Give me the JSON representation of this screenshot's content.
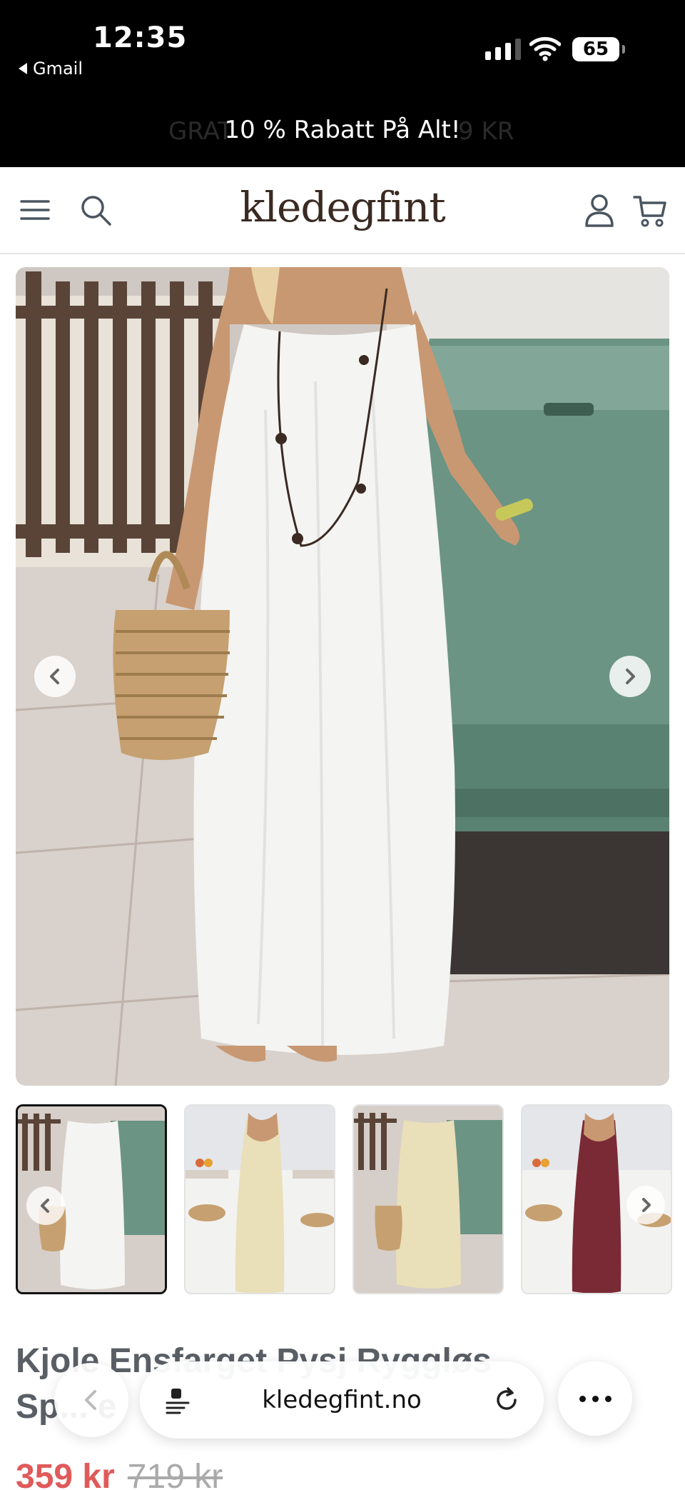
{
  "status_bar": {
    "time": "12:35",
    "back_app": "Gmail",
    "battery": "65"
  },
  "promo": {
    "text": "10 % Rabatt På Alt!",
    "ghost_left": "GRAT",
    "ghost_right": "9 KR"
  },
  "header": {
    "logo": "kledegfint",
    "icons": [
      "menu-icon",
      "search-icon",
      "account-icon",
      "cart-icon"
    ]
  },
  "gallery": {
    "colors": [
      "white",
      "beige",
      "beige",
      "burgundy"
    ],
    "active_index": 0,
    "thumb_count": 4
  },
  "product": {
    "title": "Kjole Ensfarget Pysj Ryggløs Sp... e",
    "price": "359 kr",
    "compare_price": "719 kr"
  },
  "browser": {
    "url": "kledegfint.no"
  },
  "colors": {
    "sale": "#e05a5a",
    "logo": "#3a2a22",
    "dress_white": "#f4f4f2",
    "dress_beige": "#e9dfb8",
    "dress_burgundy": "#7a2a35",
    "car_green": "#6b9484"
  }
}
